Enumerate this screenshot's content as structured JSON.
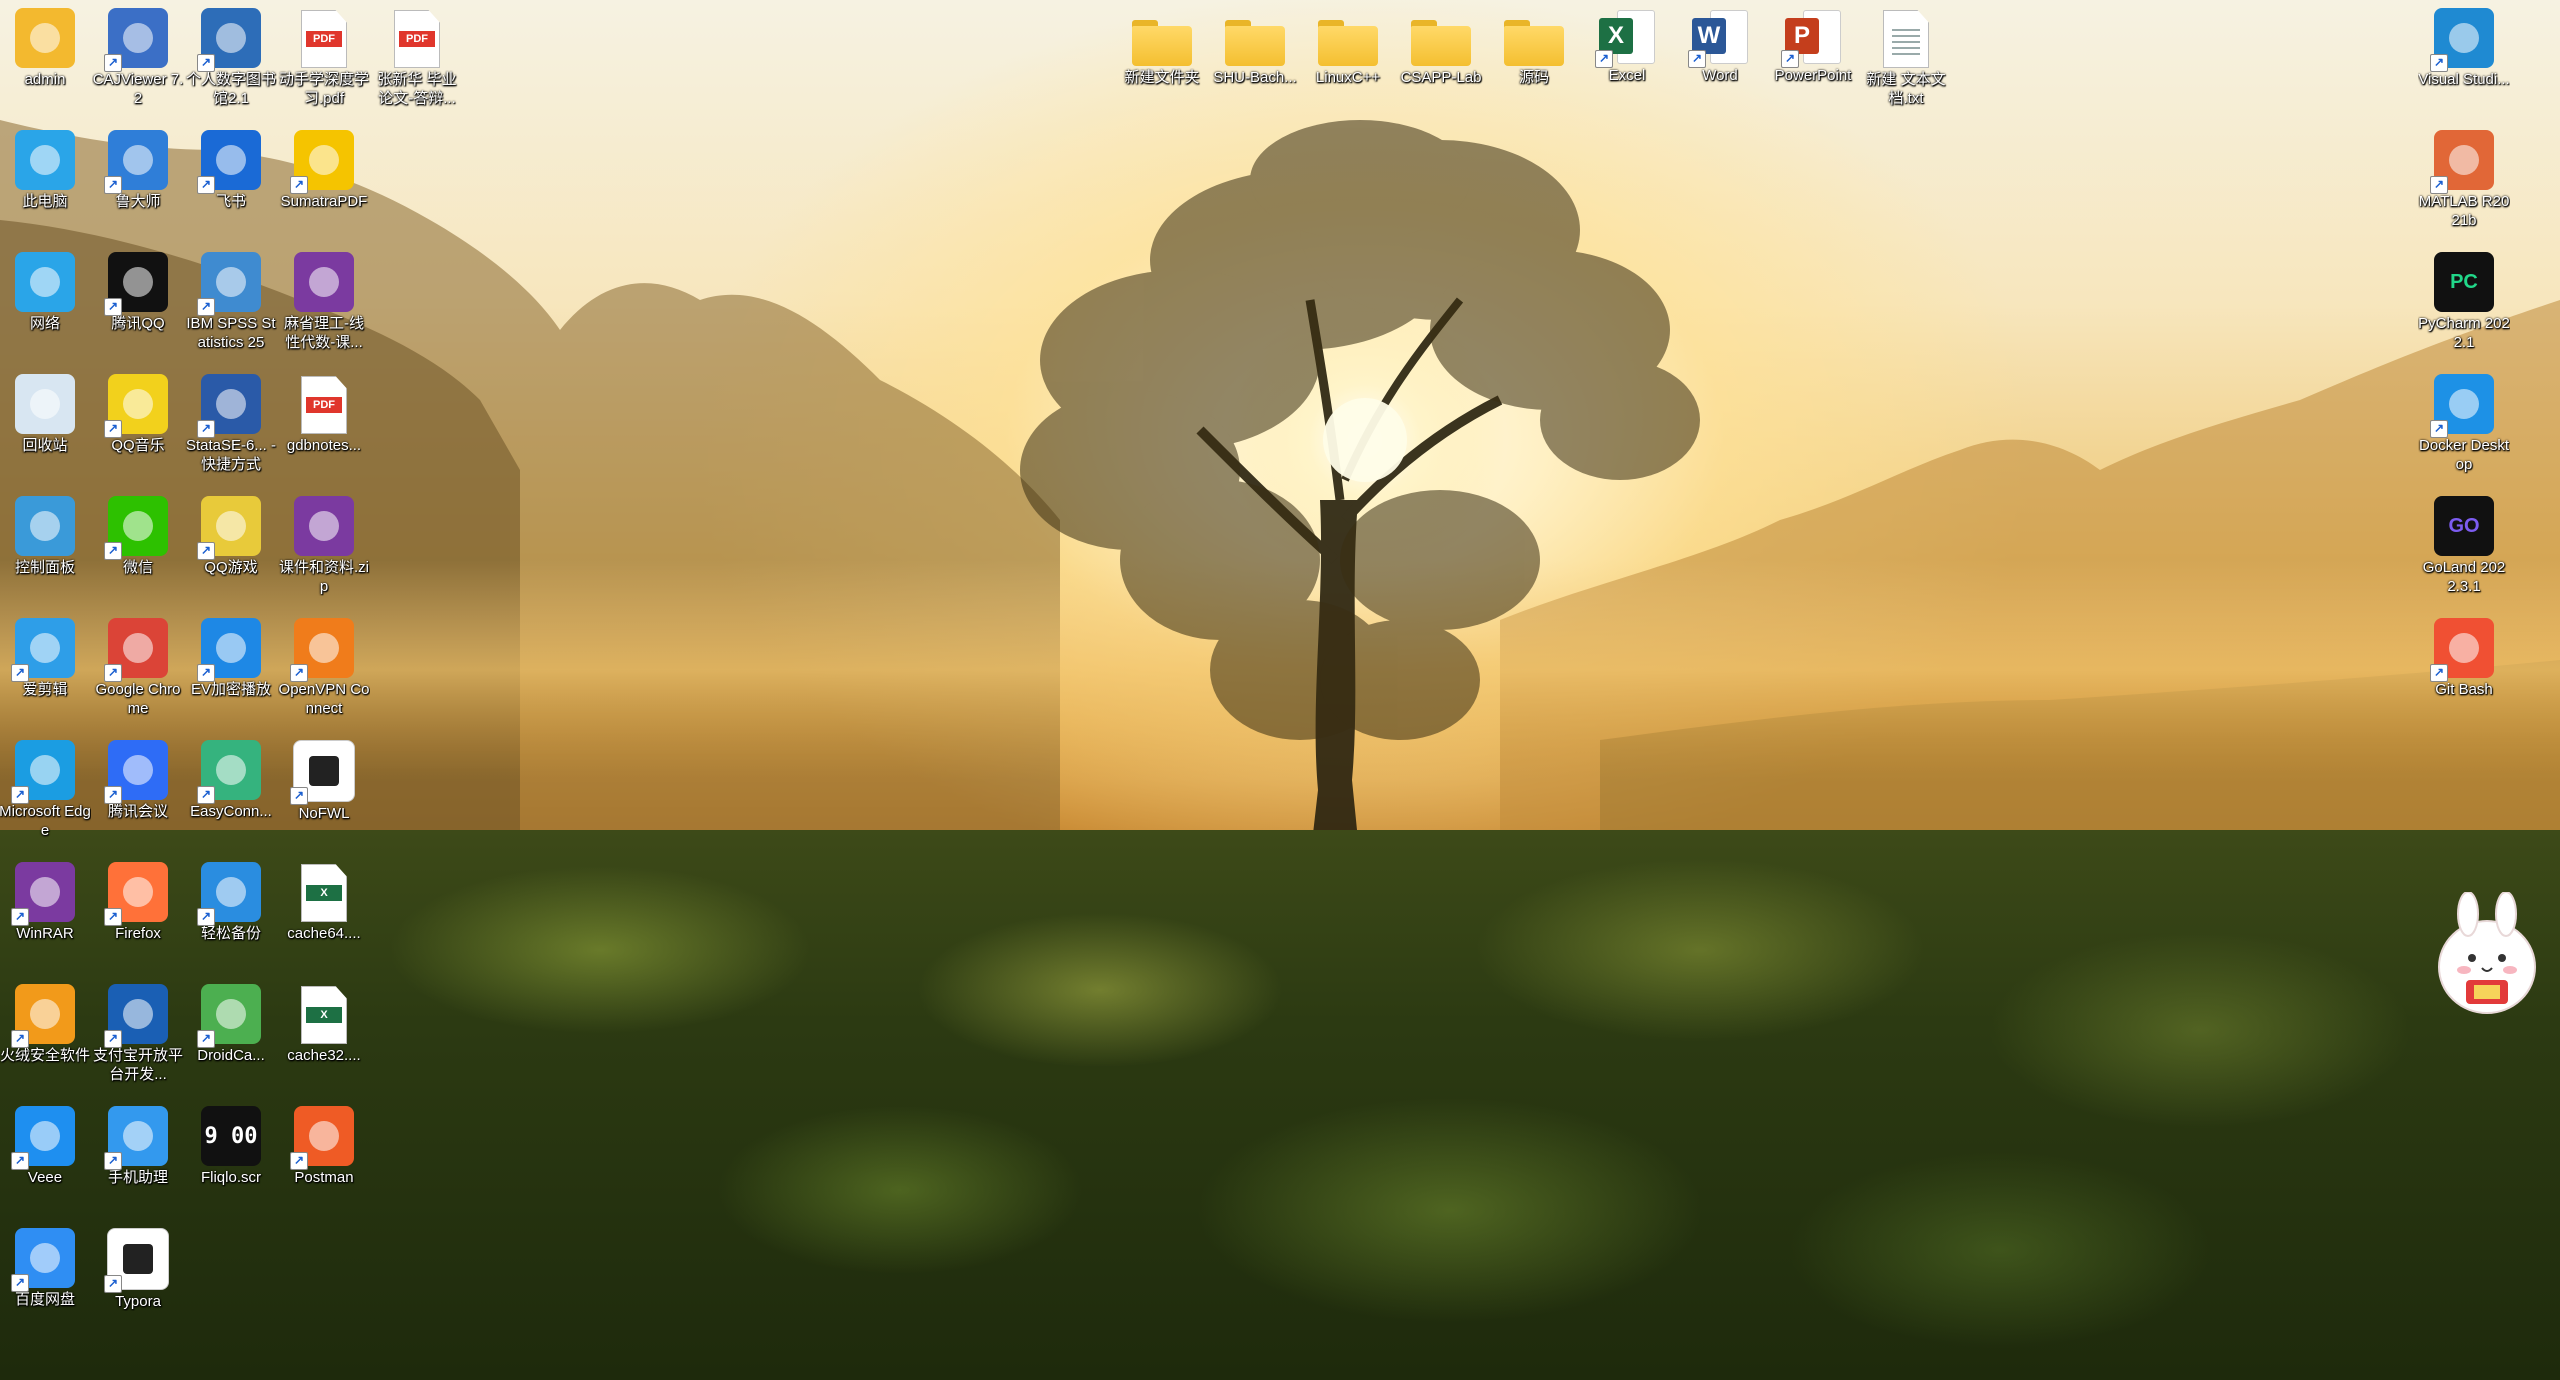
{
  "desktop": {
    "left_icons": [
      {
        "name": "admin",
        "label": "admin",
        "icon": "user-folder-icon",
        "color": "#f3b92f"
      },
      {
        "name": "cajviewer",
        "label": "CAJViewer 7.2",
        "icon": "cajviewer-icon",
        "color": "#3b6fc6",
        "shortcut": true
      },
      {
        "name": "personal-digital-book",
        "label": "个人数字图书馆2.1",
        "icon": "globe-icon",
        "color": "#2d6db8",
        "shortcut": true
      },
      {
        "name": "pdf-file-1",
        "label": "动手学深度学习.pdf",
        "icon": "pdf-file-icon",
        "color": "#e0362c"
      },
      {
        "name": "pdf-file-2",
        "label": "张新华 毕业论文-答辩...",
        "icon": "pdf-file-icon",
        "color": "#e0362c"
      },
      {
        "name": "this-pc",
        "label": "此电脑",
        "icon": "monitor-icon",
        "color": "#2aa5e8"
      },
      {
        "name": "ludashi",
        "label": "鲁大师",
        "icon": "ludashi-icon",
        "color": "#2f7ed8",
        "shortcut": true
      },
      {
        "name": "feishu",
        "label": "飞书",
        "icon": "feishu-icon",
        "color": "#1a6ad6",
        "shortcut": true
      },
      {
        "name": "sumatrapdf",
        "label": "SumatraPDF",
        "icon": "sumatrapdf-icon",
        "color": "#f5c400",
        "shortcut": true
      },
      {
        "name": "network",
        "label": "网络",
        "icon": "network-icon",
        "color": "#2aa5e8"
      },
      {
        "name": "tencent-qq",
        "label": "腾讯QQ",
        "icon": "qq-penguin-icon",
        "color": "#111111",
        "shortcut": true
      },
      {
        "name": "ibm-spss",
        "label": "IBM SPSS Statistics 25",
        "icon": "spss-icon",
        "color": "#3f8bd0",
        "shortcut": true
      },
      {
        "name": "linear-algebra-rar",
        "label": "麻省理工-线性代数-课...",
        "icon": "winrar-archive-icon",
        "color": "#7b3aa0"
      },
      {
        "name": "recycle-bin",
        "label": "回收站",
        "icon": "recycle-bin-icon",
        "color": "#d8e6f2"
      },
      {
        "name": "qq-music",
        "label": "QQ音乐",
        "icon": "qq-music-icon",
        "color": "#f2d11c",
        "shortcut": true
      },
      {
        "name": "stata",
        "label": "StataSE-6... - 快捷方式",
        "icon": "stata-icon",
        "color": "#2a5aa8",
        "shortcut": true
      },
      {
        "name": "gdbnotes-pdf",
        "label": "gdbnotes...",
        "icon": "pdf-file-icon",
        "color": "#e0362c"
      },
      {
        "name": "control-panel",
        "label": "控制面板",
        "icon": "control-panel-icon",
        "color": "#3a9ad9"
      },
      {
        "name": "wechat",
        "label": "微信",
        "icon": "wechat-icon",
        "color": "#2dc100",
        "shortcut": true
      },
      {
        "name": "qq-games",
        "label": "QQ游戏",
        "icon": "qq-games-icon",
        "color": "#e8ca3a",
        "shortcut": true
      },
      {
        "name": "courseware-zip",
        "label": "课件和资料.zip",
        "icon": "winrar-archive-icon",
        "color": "#7b3aa0"
      },
      {
        "name": "aijianji",
        "label": "爱剪辑",
        "icon": "aijianji-icon",
        "color": "#2e9ee8",
        "shortcut": true
      },
      {
        "name": "google-chrome",
        "label": "Google Chrome",
        "icon": "chrome-icon",
        "color": "#db4437",
        "shortcut": true
      },
      {
        "name": "ev-player",
        "label": "EV加密播放",
        "icon": "ev-player-icon",
        "color": "#1e88e5",
        "shortcut": true
      },
      {
        "name": "openvpn",
        "label": "OpenVPN Connect",
        "icon": "openvpn-icon",
        "color": "#f07c1b",
        "shortcut": true
      },
      {
        "name": "microsoft-edge",
        "label": "Microsoft Edge",
        "icon": "edge-icon",
        "color": "#1b9de2",
        "shortcut": true
      },
      {
        "name": "tencent-meeting",
        "label": "腾讯会议",
        "icon": "tencent-meeting-icon",
        "color": "#2e6cf6",
        "shortcut": true
      },
      {
        "name": "easyconnect",
        "label": "EasyConn...",
        "icon": "easyconnect-icon",
        "color": "#35b37e",
        "shortcut": true
      },
      {
        "name": "nofwl",
        "label": "NoFWL",
        "icon": "nofwl-icon",
        "color": "#ffffff",
        "shortcut": true
      },
      {
        "name": "winrar",
        "label": "WinRAR",
        "icon": "winrar-icon",
        "color": "#7b3aa0",
        "shortcut": true
      },
      {
        "name": "firefox",
        "label": "Firefox",
        "icon": "firefox-icon",
        "color": "#ff7139",
        "shortcut": true
      },
      {
        "name": "easy-backup",
        "label": "轻松备份",
        "icon": "backup-icon",
        "color": "#2a8de0",
        "shortcut": true
      },
      {
        "name": "cache64-xlsx",
        "label": "cache64....",
        "icon": "excel-file-icon",
        "color": "#1d7044"
      },
      {
        "name": "huorong",
        "label": "火绒安全软件",
        "icon": "huorong-icon",
        "color": "#f29a1a",
        "shortcut": true
      },
      {
        "name": "alipay-open",
        "label": "支付宝开放平台开发...",
        "icon": "alipay-shield-icon",
        "color": "#1a5fb4",
        "shortcut": true
      },
      {
        "name": "droidcam",
        "label": "DroidCa...",
        "icon": "droidcam-icon",
        "color": "#4caf50",
        "shortcut": true
      },
      {
        "name": "cache32-xlsx",
        "label": "cache32....",
        "icon": "excel-file-icon",
        "color": "#1d7044"
      },
      {
        "name": "veee",
        "label": "Veee",
        "icon": "veee-lightning-icon",
        "color": "#1e8ff0",
        "shortcut": true
      },
      {
        "name": "phone-assistant",
        "label": "手机助理",
        "icon": "phone-assistant-icon",
        "color": "#3399ee",
        "shortcut": true
      },
      {
        "name": "fliqlo",
        "label": "Fliqlo.scr",
        "icon": "flip-clock-icon",
        "color": "#111111",
        "clock": "9 00"
      },
      {
        "name": "postman",
        "label": "Postman",
        "icon": "postman-icon",
        "color": "#ef5b25",
        "shortcut": true
      },
      {
        "name": "baidu-netdisk",
        "label": "百度网盘",
        "icon": "baidu-netdisk-icon",
        "color": "#2f8ef3",
        "shortcut": true
      },
      {
        "name": "typora",
        "label": "Typora",
        "icon": "typora-icon",
        "color": "#ffffff",
        "shortcut": true
      }
    ],
    "top_icons": [
      {
        "name": "new-folder",
        "label": "新建文件夹",
        "icon": "folder-icon"
      },
      {
        "name": "shu-bach-folder",
        "label": "SHU-Bach...",
        "icon": "folder-icon"
      },
      {
        "name": "linuxc-folder",
        "label": "LinuxC++",
        "icon": "folder-icon"
      },
      {
        "name": "csapp-lab-folder",
        "label": "CSAPP-Lab",
        "icon": "folder-icon"
      },
      {
        "name": "source-code-folder",
        "label": "源码",
        "icon": "folder-icon"
      },
      {
        "name": "excel",
        "label": "Excel",
        "icon": "excel-icon",
        "color": "#1d7044",
        "letter": "X",
        "shortcut": true
      },
      {
        "name": "word",
        "label": "Word",
        "icon": "word-icon",
        "color": "#2b5797",
        "letter": "W",
        "shortcut": true
      },
      {
        "name": "powerpoint",
        "label": "PowerPoint",
        "icon": "powerpoint-icon",
        "color": "#c43e1c",
        "letter": "P",
        "shortcut": true
      },
      {
        "name": "new-text-file",
        "label": "新建 文本文档.txt",
        "icon": "text-file-icon"
      }
    ],
    "right_icons": [
      {
        "name": "vscode",
        "label": "Visual Studi...",
        "icon": "vscode-icon",
        "color": "#1f8ad2",
        "shortcut": true
      },
      {
        "name": "matlab",
        "label": "MATLAB R2021b",
        "icon": "matlab-icon",
        "color": "#e16737",
        "shortcut": true
      },
      {
        "name": "pycharm",
        "label": "PyCharm 2022.1",
        "icon": "pycharm-icon",
        "color": "#21d789",
        "letter": "PC",
        "shortcut": true
      },
      {
        "name": "docker-desktop",
        "label": "Docker Desktop",
        "icon": "docker-whale-icon",
        "color": "#1d91e6",
        "shortcut": true
      },
      {
        "name": "goland",
        "label": "GoLand 2022.3.1",
        "icon": "goland-icon",
        "color": "#7c5cf0",
        "letter": "GO",
        "shortcut": true
      },
      {
        "name": "git-bash",
        "label": "Git Bash",
        "icon": "git-bash-icon",
        "color": "#f05033",
        "shortcut": true
      }
    ]
  }
}
